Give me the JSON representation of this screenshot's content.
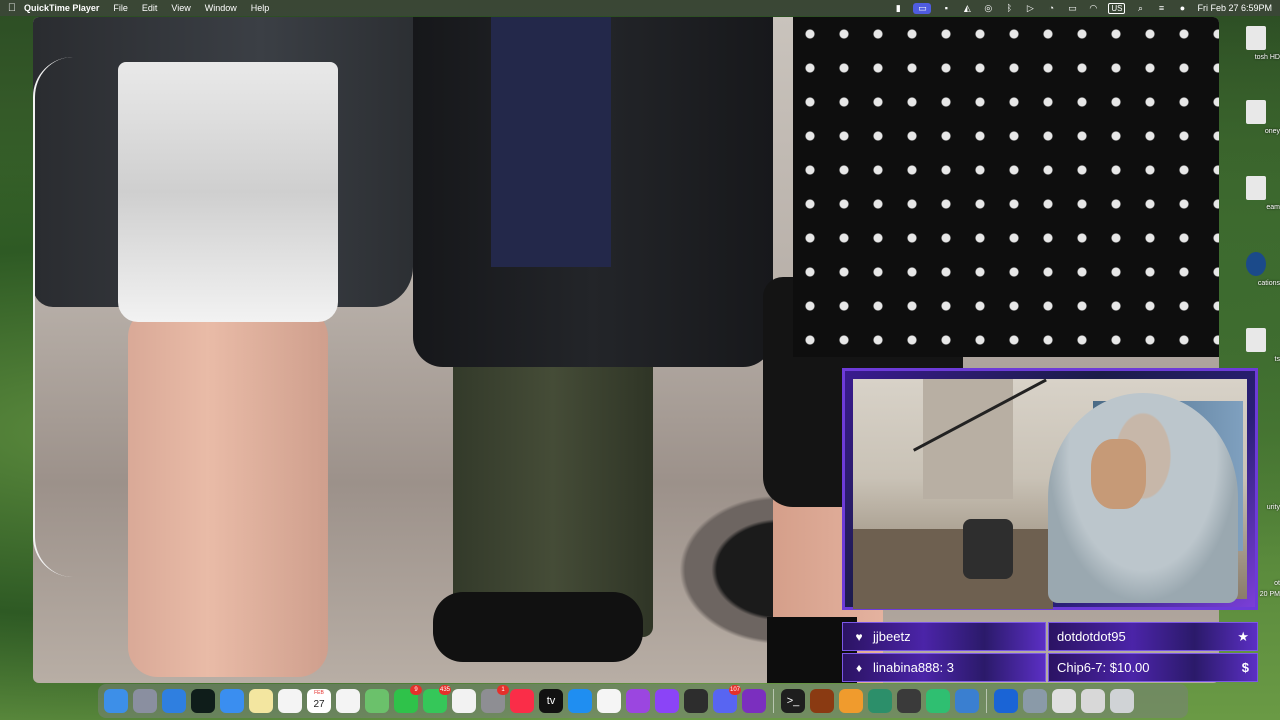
{
  "menubar": {
    "apple_icon": "apple-icon",
    "app_name": "QuickTime Player",
    "menus": [
      "File",
      "Edit",
      "View",
      "Window",
      "Help"
    ],
    "status_icons": [
      "stickies-icon",
      "screen-record-icon",
      "terminal-icon",
      "vpn-icon",
      "network-icon",
      "bluetooth-icon",
      "play-icon",
      "time-machine-icon",
      "battery-icon",
      "wifi-icon",
      "spotlight-icon",
      "control-center-icon",
      "siri-icon"
    ],
    "keyboard_layout": "US",
    "datetime": "Fri Feb 27  6:59PM"
  },
  "desktop_icons": [
    {
      "label": "tosh HD",
      "icon": "hard-drive-icon"
    },
    {
      "label": "oney",
      "icon": "document-icon"
    },
    {
      "label": "eam",
      "icon": "document-icon"
    },
    {
      "label": "cations",
      "icon": "steam-icon"
    },
    {
      "label": "ts",
      "icon": "document-icon"
    },
    {
      "label": "urity",
      "icon": "document-icon"
    },
    {
      "label": "ot",
      "icon": "document-icon"
    },
    {
      "label": "20 PM",
      "icon": "document-icon"
    }
  ],
  "overlay": {
    "latest_follower": "jjbeetz",
    "latest_sub": "dotdotdot95",
    "latest_bits": "linabina888: 3",
    "latest_donation": "Chip6-7: $10.00",
    "follow_icon": "heart-icon",
    "sub_icon": "star-icon",
    "bits_icon": "diamond-icon",
    "donation_icon": "dollar-icon",
    "sub_symbol": "★",
    "donation_symbol": "$",
    "follow_symbol": "♥",
    "bits_symbol": "♦"
  },
  "dock": {
    "items": [
      {
        "name": "finder-icon",
        "color": "#3d8fe8",
        "glyph": ""
      },
      {
        "name": "launchpad-icon",
        "color": "#8a8fa0",
        "glyph": ""
      },
      {
        "name": "safari-icon",
        "color": "#2f7fe0",
        "glyph": ""
      },
      {
        "name": "chatgpt-icon",
        "color": "#0f1d1a",
        "glyph": ""
      },
      {
        "name": "mail-icon",
        "color": "#3a8ef0",
        "glyph": ""
      },
      {
        "name": "notes-icon",
        "color": "#f3e6a0",
        "glyph": ""
      },
      {
        "name": "freeform-icon",
        "color": "#f4f4f4",
        "glyph": ""
      },
      {
        "name": "calendar-icon",
        "color": "#ffffff",
        "glyph": "27",
        "top": "FEB"
      },
      {
        "name": "reminders-icon",
        "color": "#f4f4f4",
        "glyph": ""
      },
      {
        "name": "maps-icon",
        "color": "#6bc16b",
        "glyph": ""
      },
      {
        "name": "facetime-icon",
        "color": "#2fc24a",
        "glyph": "",
        "badge": "9"
      },
      {
        "name": "messages-icon",
        "color": "#35c759",
        "glyph": "",
        "badge": "435"
      },
      {
        "name": "news-icon",
        "color": "#f2f2f2",
        "glyph": ""
      },
      {
        "name": "system-settings-icon",
        "color": "#8e8e93",
        "glyph": "",
        "badge": "1"
      },
      {
        "name": "music-icon",
        "color": "#fa2d48",
        "glyph": ""
      },
      {
        "name": "tv-icon",
        "color": "#111111",
        "glyph": "tv"
      },
      {
        "name": "app-store-icon",
        "color": "#1f8ef1",
        "glyph": ""
      },
      {
        "name": "photos-icon",
        "color": "#f5f5f5",
        "glyph": ""
      },
      {
        "name": "podcasts-icon",
        "color": "#9b46e0",
        "glyph": ""
      },
      {
        "name": "twitch-icon",
        "color": "#8b44f7",
        "glyph": ""
      },
      {
        "name": "final-cut-icon",
        "color": "#2d2d2d",
        "glyph": ""
      },
      {
        "name": "discord-icon",
        "color": "#5865f2",
        "glyph": "",
        "badge": "107"
      },
      {
        "name": "onenote-icon",
        "color": "#7b2fbf",
        "glyph": ""
      },
      {
        "name": "divider",
        "color": "",
        "glyph": ""
      },
      {
        "name": "terminal-icon",
        "color": "#1e1e1e",
        "glyph": ">_"
      },
      {
        "name": "game-icon",
        "color": "#8a3a12",
        "glyph": ""
      },
      {
        "name": "sublime-icon",
        "color": "#f09b2d",
        "glyph": ""
      },
      {
        "name": "xcode-icon",
        "color": "#2c8f6a",
        "glyph": ""
      },
      {
        "name": "guitar-icon",
        "color": "#3a3a3a",
        "glyph": ""
      },
      {
        "name": "chat-icon",
        "color": "#2fbf71",
        "glyph": ""
      },
      {
        "name": "preview-icon",
        "color": "#3a7fd0",
        "glyph": ""
      },
      {
        "name": "divider",
        "color": "",
        "glyph": ""
      },
      {
        "name": "1password-icon",
        "color": "#1a64d6",
        "glyph": ""
      },
      {
        "name": "folder-icon",
        "color": "#8a9aa8",
        "glyph": ""
      },
      {
        "name": "document-icon",
        "color": "#e0e0e0",
        "glyph": ""
      },
      {
        "name": "screenshot-icon",
        "color": "#d8d8d8",
        "glyph": ""
      },
      {
        "name": "trash-icon",
        "color": "#d0d3d6",
        "glyph": ""
      }
    ]
  }
}
